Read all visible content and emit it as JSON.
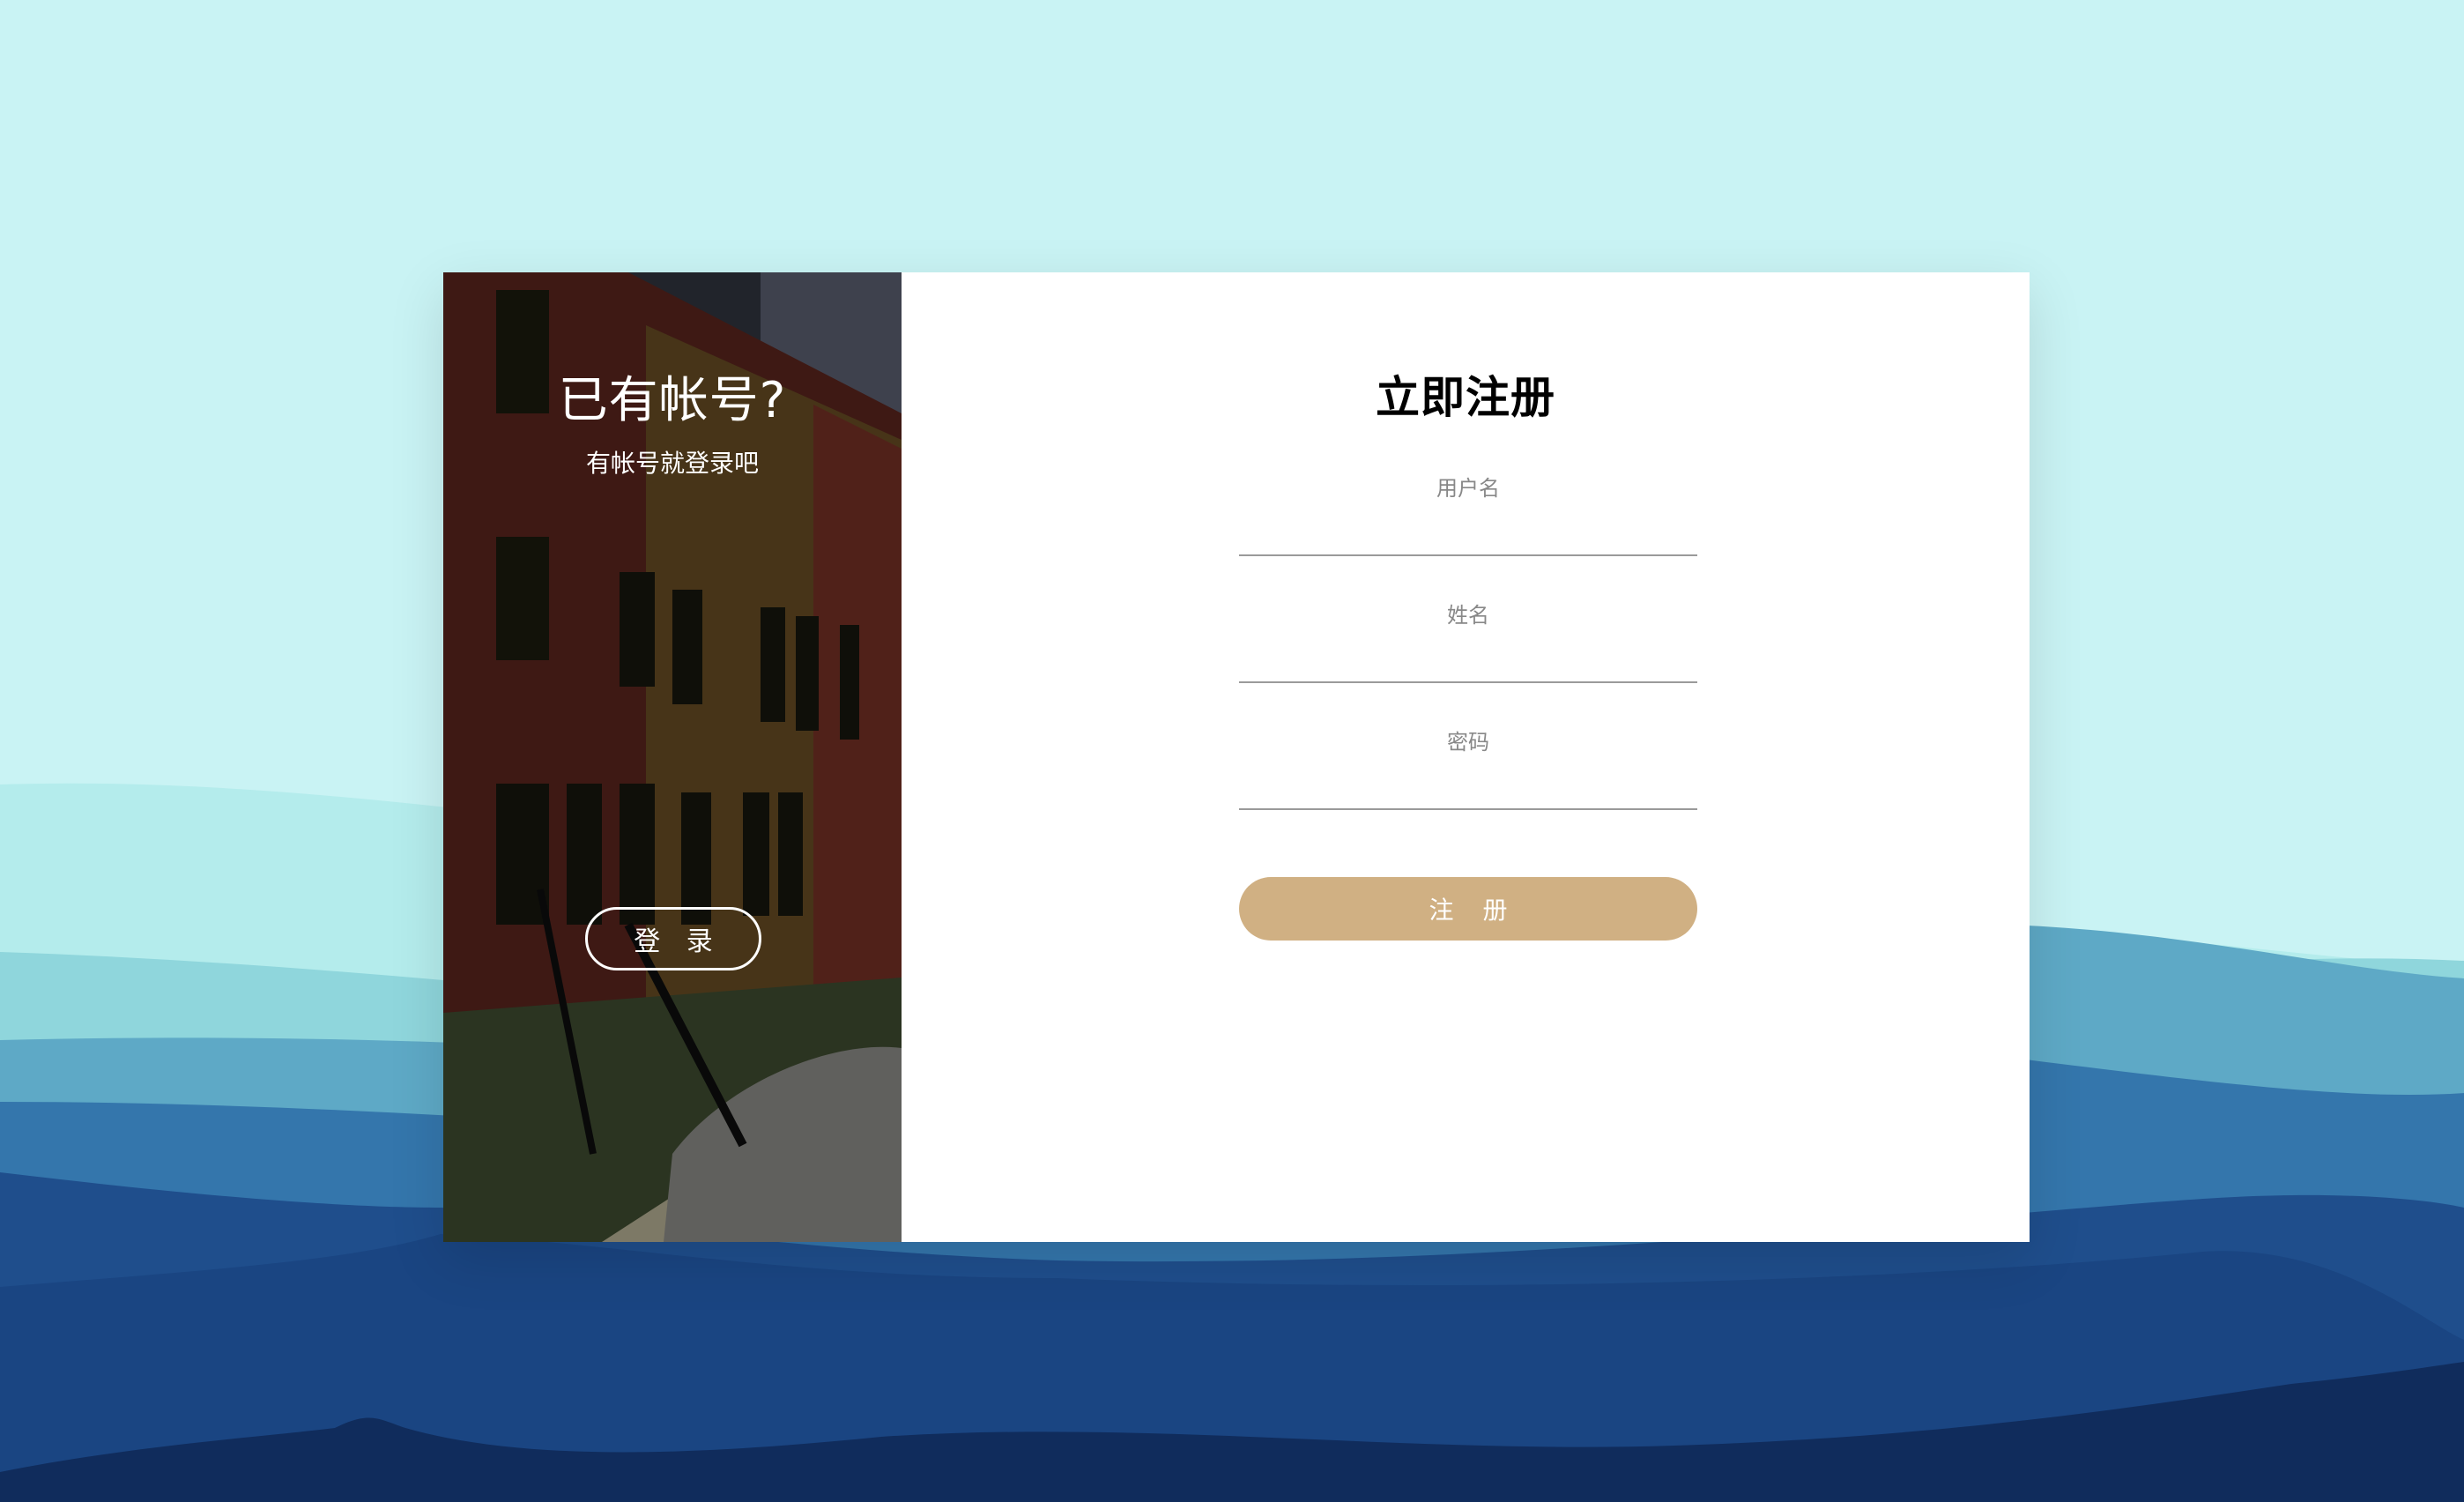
{
  "colors": {
    "sky": "#c9f3f4",
    "accent": "#d0b083",
    "card": "#ffffff",
    "underline": "#9a9a9a",
    "label": "#888888"
  },
  "side": {
    "title": "已有帐号?",
    "subtitle": "有帐号就登录吧",
    "login_button": "登 录"
  },
  "form": {
    "title": "立即注册",
    "fields": [
      {
        "label": "用户名",
        "value": ""
      },
      {
        "label": "姓名",
        "value": ""
      },
      {
        "label": "密码",
        "value": ""
      }
    ],
    "register_button": "注 册"
  }
}
